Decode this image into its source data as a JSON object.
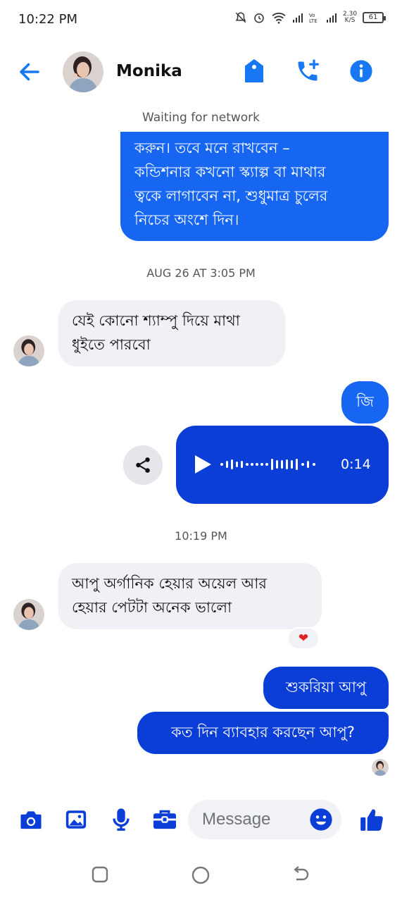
{
  "status_bar": {
    "time": "10:22 PM",
    "net_speed_value": "2.30",
    "net_speed_unit": "K/S",
    "battery": "61"
  },
  "header": {
    "contact_name": "Monika",
    "icons": [
      "back-arrow-icon",
      "tag-icon",
      "add-call-icon",
      "info-icon"
    ],
    "accent_color": "#1877f2"
  },
  "messages": {
    "network_status": "Waiting for network",
    "outgoing_long": [
      "করুন। তবে মনে রাখবেন –",
      "কন্ডিশনার কখনো স্ক্যাল্প বা মাথার",
      "ত্বকে লাগাবেন না, শুধুমাত্র চুলের",
      "নিচের অংশে দিন।"
    ],
    "timestamp_1": "AUG 26 AT 3:05 PM",
    "incoming_1": [
      "যেই কোনো শ্যাম্পু দিয়ে মাথা",
      "ধুইতে পারবো"
    ],
    "outgoing_short": "জি",
    "voice_duration": "0:14",
    "timestamp_2": "10:19 PM",
    "incoming_2": [
      "আপু অর্গানিক হেয়ার অয়েল আর",
      "হেয়ার পেটটা অনেক ভালো"
    ],
    "reaction": "❤",
    "outgoing_thanks": "শুকরিয়া আপু",
    "outgoing_question": "কত দিন ব্যাবহার করছেন আপু?"
  },
  "composer": {
    "placeholder": "Message",
    "icons": [
      "camera-icon",
      "gallery-icon",
      "mic-icon",
      "toolbox-icon",
      "emoji-icon",
      "thumbs-up-icon"
    ]
  },
  "colors": {
    "bubble_outgoing": "#1766f2",
    "bubble_outgoing_dark": "#0a3ed6",
    "bubble_incoming": "#eff1f5"
  }
}
